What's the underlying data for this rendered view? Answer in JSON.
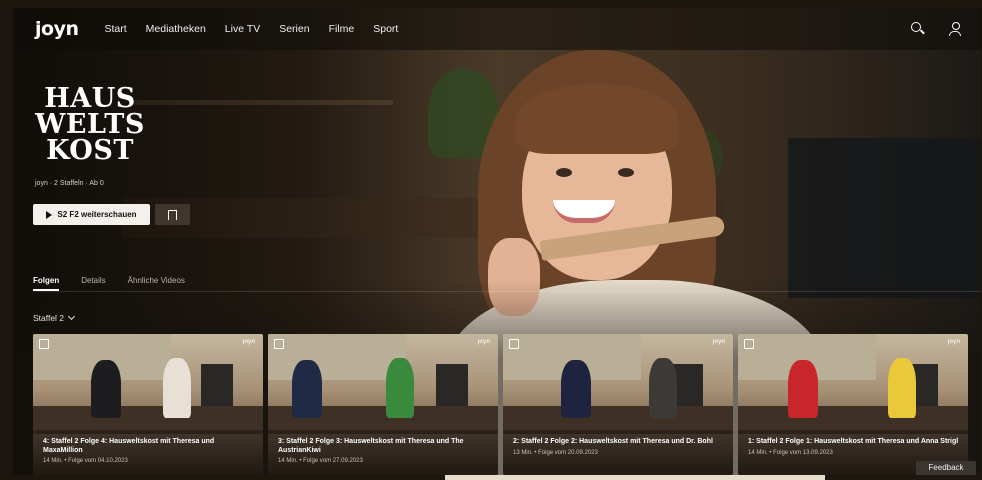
{
  "nav": {
    "logo": "JOYN",
    "items": [
      "Start",
      "Mediatheken",
      "Live TV",
      "Serien",
      "Filme",
      "Sport"
    ]
  },
  "hero": {
    "show_logo": [
      "HAUS",
      "WELTS",
      "KOST"
    ],
    "meta": "joyn · 2 Staffeln · Ab 0",
    "play_label": "S2 F2 weiterschauen"
  },
  "tabs": [
    "Folgen",
    "Details",
    "Ähnliche Videos"
  ],
  "season_select": "Staffel 2",
  "episodes": [
    {
      "title": "4: Staffel 2 Folge 4: Hausweltskost mit Theresa und MaxaMillion",
      "sub": "14 Min. • Folge vom 04.10.2023"
    },
    {
      "title": "3: Staffel 2 Folge 3: Hausweltskost mit Theresa und The AustrianKiwi",
      "sub": "14 Min. • Folge vom 27.09.2023"
    },
    {
      "title": "2: Staffel 2 Folge 2: Hausweltskost mit Theresa und Dr. Bohl",
      "sub": "13 Min. • Folge vom 20.09.2023"
    },
    {
      "title": "1: Staffel 2 Folge 1: Hausweltskost mit Theresa und Anna Strigl",
      "sub": "14 Min. • Folge vom 13.09.2023"
    }
  ],
  "card_brand": "joyn",
  "feedback_label": "Feedback",
  "icons": [
    "search-icon",
    "user-icon",
    "play-icon",
    "bookmark-icon",
    "chevron-down-icon"
  ]
}
